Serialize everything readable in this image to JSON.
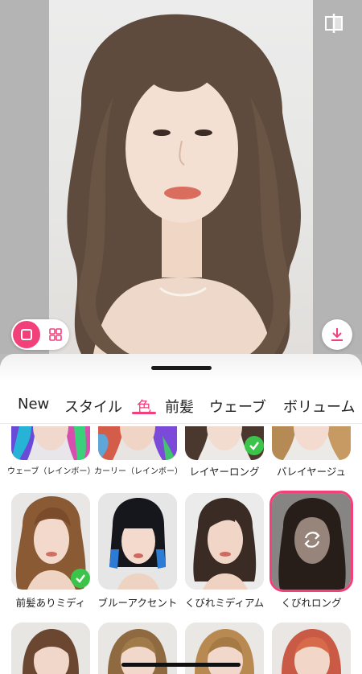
{
  "icons": {
    "compare": "compare-split-icon",
    "single_view": "single-view-icon",
    "grid_view": "grid-view-icon",
    "download": "download-icon",
    "selected_check": "check-icon",
    "swap": "swap-arrows-icon"
  },
  "colors": {
    "accent": "#f2407a",
    "check": "#3cc44a"
  },
  "tabs": [
    {
      "label": "New"
    },
    {
      "label": "スタイル"
    },
    {
      "label": "色",
      "active": true
    },
    {
      "label": "前髪"
    },
    {
      "label": "ウェーブ"
    },
    {
      "label": "ボリューム"
    }
  ],
  "styles_row1": [
    {
      "label": "ウェーブ（レインボー）"
    },
    {
      "label": "カーリー（レインボー）"
    },
    {
      "label": "レイヤーロング",
      "checked": true
    },
    {
      "label": "バレイヤージュ"
    }
  ],
  "styles_row2": [
    {
      "label": "前髪ありミディ",
      "checked": true
    },
    {
      "label": "ブルーアクセント"
    },
    {
      "label": "くびれミディアム"
    },
    {
      "label": "くびれロング",
      "selected": true
    }
  ]
}
